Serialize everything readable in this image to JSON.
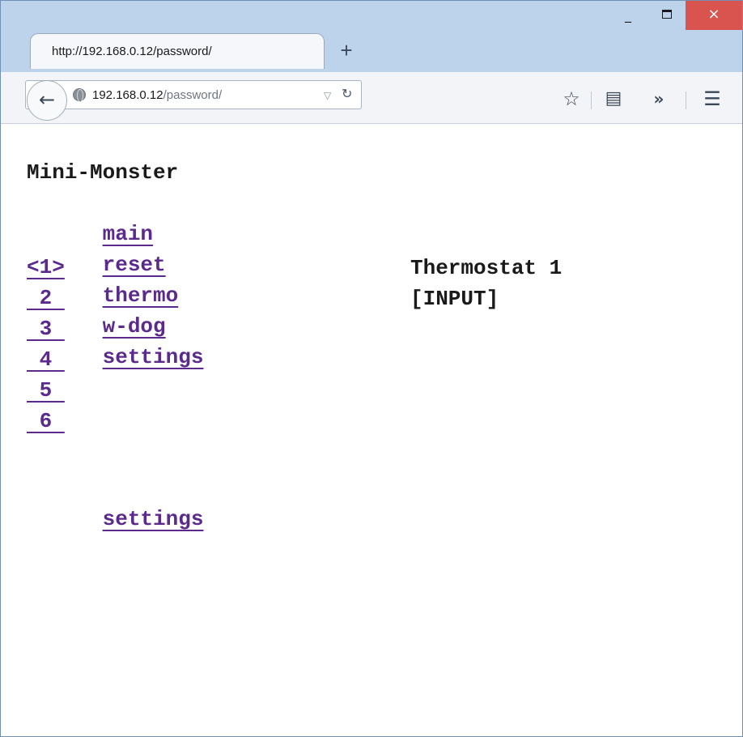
{
  "browser": {
    "tab_title": "http://192.168.0.12/password/",
    "new_tab_label": "+",
    "window_controls": {
      "minimize": "_",
      "close": "×"
    },
    "url_host": "192.168.0.12",
    "url_path": "/password/",
    "icons": [
      "back-arrow-icon",
      "globe-icon",
      "dropmarker-icon",
      "reload-icon",
      "star-icon",
      "reader-icon",
      "overflow-icon",
      "menu-icon"
    ]
  },
  "page": {
    "title": "Mini-Monster",
    "nav": [
      "main",
      "reset",
      "thermo",
      "w-dog",
      "settings"
    ],
    "thermostats": [
      "<1>",
      " 2 ",
      " 3 ",
      " 4 ",
      " 5 ",
      " 6 "
    ],
    "thermo_title": "Thermostat 1",
    "thermo_value": "[INPUT]",
    "footer_link": "settings",
    "colors": {
      "link": "#5b2a8c",
      "text": "#1a1a1a"
    }
  }
}
